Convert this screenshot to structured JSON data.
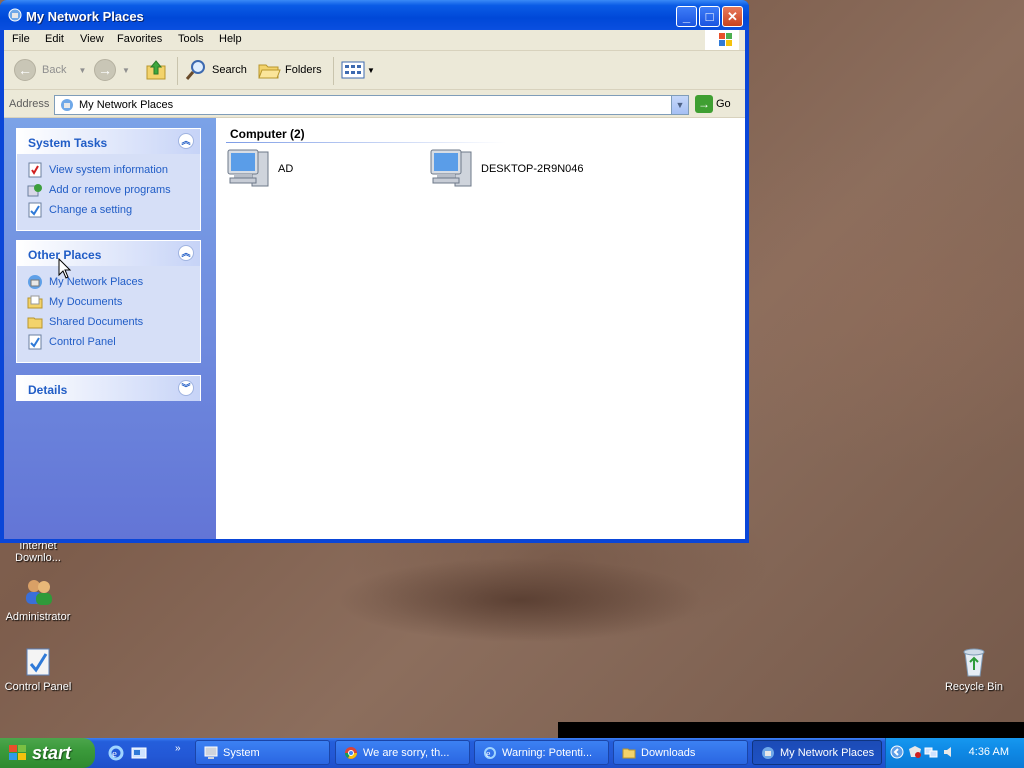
{
  "window": {
    "title": "My Network Places",
    "menu": [
      "File",
      "Edit",
      "View",
      "Favorites",
      "Tools",
      "Help"
    ],
    "toolbar": {
      "back": "Back",
      "search": "Search",
      "folders": "Folders"
    },
    "address": {
      "label": "Address",
      "value": "My Network Places",
      "go": "Go"
    }
  },
  "sidebar": {
    "system_tasks": {
      "title": "System Tasks",
      "links": [
        "View system information",
        "Add or remove programs",
        "Change a setting"
      ]
    },
    "other_places": {
      "title": "Other Places",
      "links": [
        "My Network Places",
        "My Documents",
        "Shared Documents",
        "Control Panel"
      ]
    },
    "details": {
      "title": "Details"
    }
  },
  "content": {
    "group_header": "Computer (2)",
    "items": [
      "AD",
      "DESKTOP-2R9N046"
    ]
  },
  "desktop_icons": [
    {
      "line1": "Internet",
      "line2": "Downlo..."
    },
    {
      "label": "Administrator"
    },
    {
      "label": "Control Panel"
    },
    {
      "label": "Recycle Bin"
    }
  ],
  "taskbar": {
    "start": "start",
    "tasks": [
      "System",
      "We are sorry, th...",
      "Warning: Potenti...",
      "Downloads",
      "My Network Places"
    ],
    "active_task": "My Network Places",
    "clock": "4:36 AM"
  }
}
